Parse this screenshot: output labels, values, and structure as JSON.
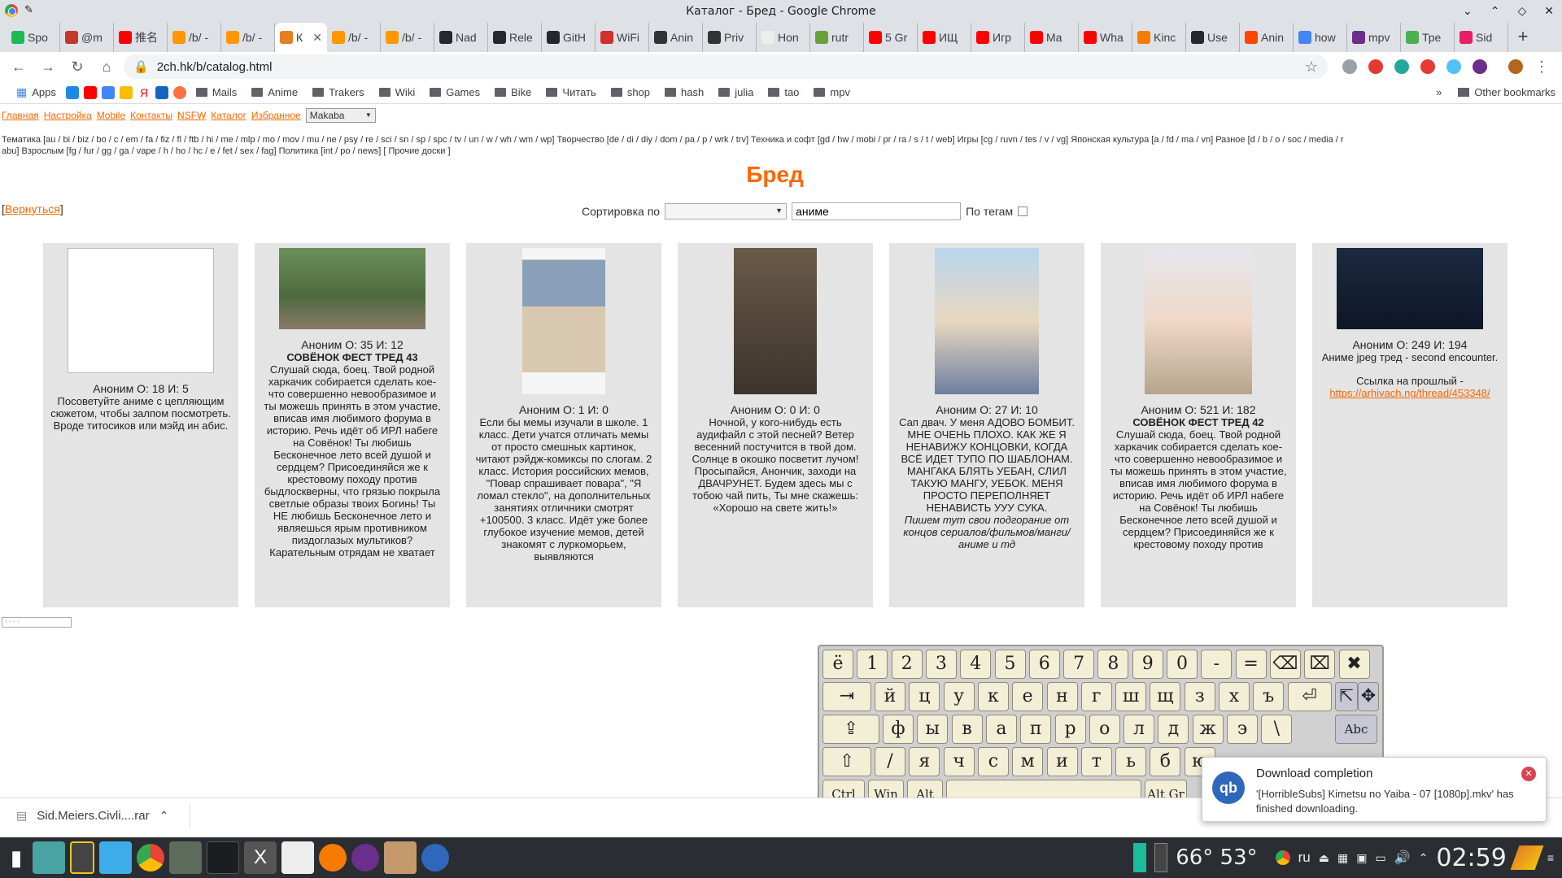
{
  "window": {
    "title": "Каталог - Бред - Google Chrome"
  },
  "tabs": [
    {
      "label": "Spo",
      "color": "#1db954"
    },
    {
      "label": "@m",
      "color": "#c0392b"
    },
    {
      "label": "推名",
      "color": "#ff0000"
    },
    {
      "label": "/b/ -",
      "color": "#ff9800"
    },
    {
      "label": "/b/ -",
      "color": "#ff9800"
    },
    {
      "label": "К",
      "color": "#e67e22",
      "active": true
    },
    {
      "label": "/b/ -",
      "color": "#ff9800"
    },
    {
      "label": "/b/ -",
      "color": "#ff9800"
    },
    {
      "label": "Nad",
      "color": "#24292e"
    },
    {
      "label": "Rele",
      "color": "#24292e"
    },
    {
      "label": "GitH",
      "color": "#24292e"
    },
    {
      "label": "WiFi",
      "color": "#d32f2f"
    },
    {
      "label": "Anin",
      "color": "#333333"
    },
    {
      "label": "Priv",
      "color": "#333333"
    },
    {
      "label": "Hon",
      "color": "#eeeeee"
    },
    {
      "label": "rutr",
      "color": "#6a9f3a"
    },
    {
      "label": "5 Gr",
      "color": "#ff0000"
    },
    {
      "label": "ИЩ",
      "color": "#ff0000"
    },
    {
      "label": "Игр",
      "color": "#ff0000"
    },
    {
      "label": "Ma",
      "color": "#ff0000"
    },
    {
      "label": "Wha",
      "color": "#ff0000"
    },
    {
      "label": "Kinc",
      "color": "#f57c00"
    },
    {
      "label": "Use",
      "color": "#24292e"
    },
    {
      "label": "Anin",
      "color": "#ff4500"
    },
    {
      "label": "how",
      "color": "#4285f4"
    },
    {
      "label": "mpv",
      "color": "#6a2f8a"
    },
    {
      "label": "Тре",
      "color": "#4caf50"
    },
    {
      "label": "Sid",
      "color": "#e91e63"
    }
  ],
  "omnibox": {
    "url": "2ch.hk/b/catalog.html"
  },
  "bookmarks": {
    "apps_label": "Apps",
    "folders": [
      "Mails",
      "Anime",
      "Trakers",
      "Wiki",
      "Games",
      "Bike",
      "Читать",
      "shop",
      "hash",
      "julia",
      "tao",
      "mpv"
    ],
    "other_label": "Other bookmarks"
  },
  "topnav": {
    "links": [
      "Главная",
      "Настройка",
      "Mobile",
      "Контакты",
      "NSFW",
      "Каталог",
      "Избранное"
    ],
    "style_select": "Makaba"
  },
  "boards_line1": "Тематика [au / bi / biz / bo / c / em / fa / fiz / fl / ftb / hi / me / mlp / mo / mov / mu / ne / psy / re / sci / sn / sp / spc / tv / un / w / wh / wm / wp]   Творчество [de / di / diy / dom / pa / p / wrk / trv]   Техника и софт [gd / hw / mobi / pr / ra / s / t / web]   Игры [cg / ruvn / tes / v / vg]   Японская культура [a / fd / ma / vn]   Разное [d / b / o / soc / media / r",
  "boards_line2": "abu]   Взрослым [fg / fur / gg / ga / vape / h / ho / hc / e / fet / sex / fag]   Политика [int / po / news]   [ Прочие доски ]",
  "board": {
    "title": "Бред",
    "back": "Вернуться"
  },
  "sort": {
    "label": "Сортировка по",
    "search_value": "аниме",
    "tags_label": "По тегам"
  },
  "threads": [
    {
      "meta": "Аноним  О: 18 И: 5",
      "subject": "",
      "body": "Посоветуйте аниме с цепляющим сюжетом, чтобы залпом посмотреть. Вроде титосиков или мэйд ин абис."
    },
    {
      "meta": "Аноним  О: 35 И: 12",
      "subject": "СОВЁНОК ФЕСТ ТРЕД 43",
      "body": "Слушай сюда, боец. Твой родной харкачик собирается сделать кое-что совершенно невообразимое и ты можешь принять в этом участие, вписав имя любимого форума в историю. Речь идёт об ИРЛ набеге на Совёнок! Ты любишь Бесконечное лето всей душой и сердцем? Присоединяйся же к крестовому походу против быдлоскверны, что грязью покрыла светлые образы твоих Богинь! Ты НЕ любишь Бесконечное лето и являешься ярым противником пиздоглазых мультиков? Карательным отрядам не хватает"
    },
    {
      "meta": "Аноним  О: 1 И: 0",
      "subject": "",
      "body": "Если бы мемы изучали в школе. 1 класс. Дети учатся отличать мемы от просто смешных картинок, читают рэйдж-комиксы по слогам. 2 класс. История российских мемов, \"Повар спрашивает повара\", \"Я ломал стекло\", на дополнительных занятиях отличники смотрят +100500. 3 класс. Идёт уже более глубокое изучение мемов, детей знакомят с луркоморьем, выявляются"
    },
    {
      "meta": "Аноним  О: 0 И: 0",
      "subject": "",
      "body": "Ночной, у кого-нибудь есть аудифайл с этой песней? Ветер весенний постучится в твой дом. Солнце в окошко посветит лучом! Просыпайся, Анончик, заходи на ДВАЧРУНЕТ. Будем здесь мы с тобою чай пить, Ты мне скажешь: «Хорошо на свете жить!»"
    },
    {
      "meta": "Аноним  О: 27 И: 10",
      "subject": "",
      "body": "Сап двач. У меня АДОВО БОМБИТ. МНЕ ОЧЕНЬ ПЛОХО. КАК ЖЕ Я НЕНАВИЖУ КОНЦОВКИ, КОГДА ВСЁ ИДЕТ ТУПО ПО ШАБЛОНАМ. МАНГАКА БЛЯТЬ УЕБАН, СЛИЛ ТАКУЮ МАНГУ, УЕБОК. МЕНЯ ПРОСТО ПЕРЕПОЛНЯЕТ НЕНАВИСТЬ УУУ СУКА.",
      "italic": "Пишем тут свои подгорание от концов сериалов/фильмов/манги/ аниме и тд"
    },
    {
      "meta": "Аноним  О: 521 И: 182",
      "subject": "СОВЁНОК ФЕСТ ТРЕД 42",
      "body": "Слушай сюда, боец. Твой родной харкачик собирается сделать кое-что совершенно невообразимое и ты можешь принять в этом участие, вписав имя любимого форума в историю. Речь идёт об ИРЛ набеге на Совёнок! Ты любишь Бесконечное лето всей душой и сердцем? Присоединяйся же к крестовому походу против"
    },
    {
      "meta": "Аноним  О: 249 И: 194",
      "subject": "",
      "body": "Аниме jpeg тред - second encounter.",
      "link_prefix": "Ссылка на прошлый -",
      "link": "https://arhivach.ng/thread/453348/"
    }
  ],
  "keyboard": {
    "row1": [
      "ё",
      "1",
      "2",
      "3",
      "4",
      "5",
      "6",
      "7",
      "8",
      "9",
      "0",
      "-",
      "="
    ],
    "row2": [
      "й",
      "ц",
      "у",
      "к",
      "е",
      "н",
      "г",
      "ш",
      "щ",
      "з",
      "х",
      "ъ"
    ],
    "row3": [
      "ф",
      "ы",
      "в",
      "а",
      "п",
      "р",
      "о",
      "л",
      "д",
      "ж",
      "э",
      "\\"
    ],
    "row4": [
      "/",
      "я",
      "ч",
      "с",
      "м",
      "и",
      "т",
      "ь",
      "б",
      "ю"
    ],
    "ctrl": "Ctrl",
    "win": "Win",
    "alt": "Alt",
    "altgr": "Alt Gr",
    "abc": "Abc"
  },
  "notification": {
    "title": "Download completion",
    "body": "'[HorribleSubs] Kimetsu no Yaiba - 07 [1080p].mkv' has finished downloading."
  },
  "downloads": {
    "file": "Sid.Meiers.Civli....rar"
  },
  "taskbar": {
    "temps": "66° 53°",
    "lang": "ru",
    "clock": "02:59"
  }
}
